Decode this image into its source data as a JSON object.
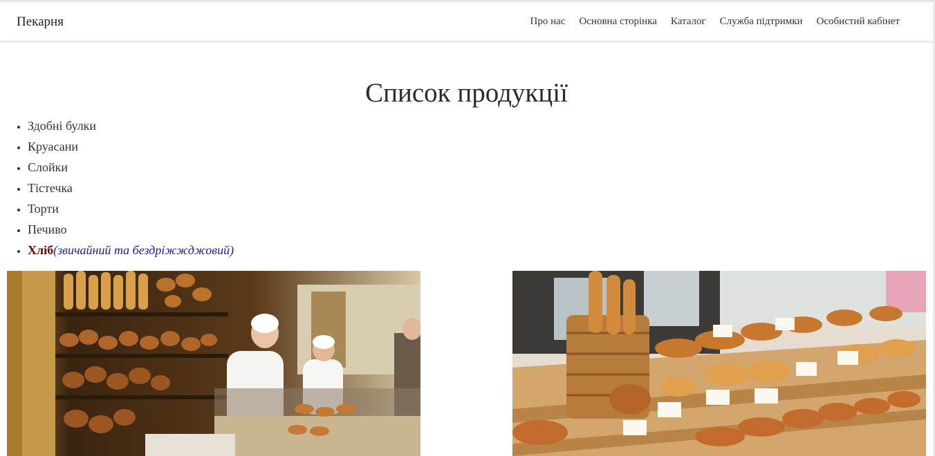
{
  "navbar": {
    "brand": "Пекарня",
    "links": [
      "Про нас",
      "Основна сторінка",
      "Каталог",
      "Служба підтримки",
      "Особистий кабінет"
    ]
  },
  "main": {
    "title": "Список продукції",
    "products": [
      "Здобні булки",
      "Круасани",
      "Слойки",
      "Тістечка",
      "Торти",
      "Печиво"
    ],
    "bread": {
      "name": "Хліб",
      "note": "(звичайний та бездріжжджовий)"
    }
  },
  "colors": {
    "bread_name": "#6b0000",
    "bread_note": "#1a1aa6",
    "text": "#333333"
  }
}
